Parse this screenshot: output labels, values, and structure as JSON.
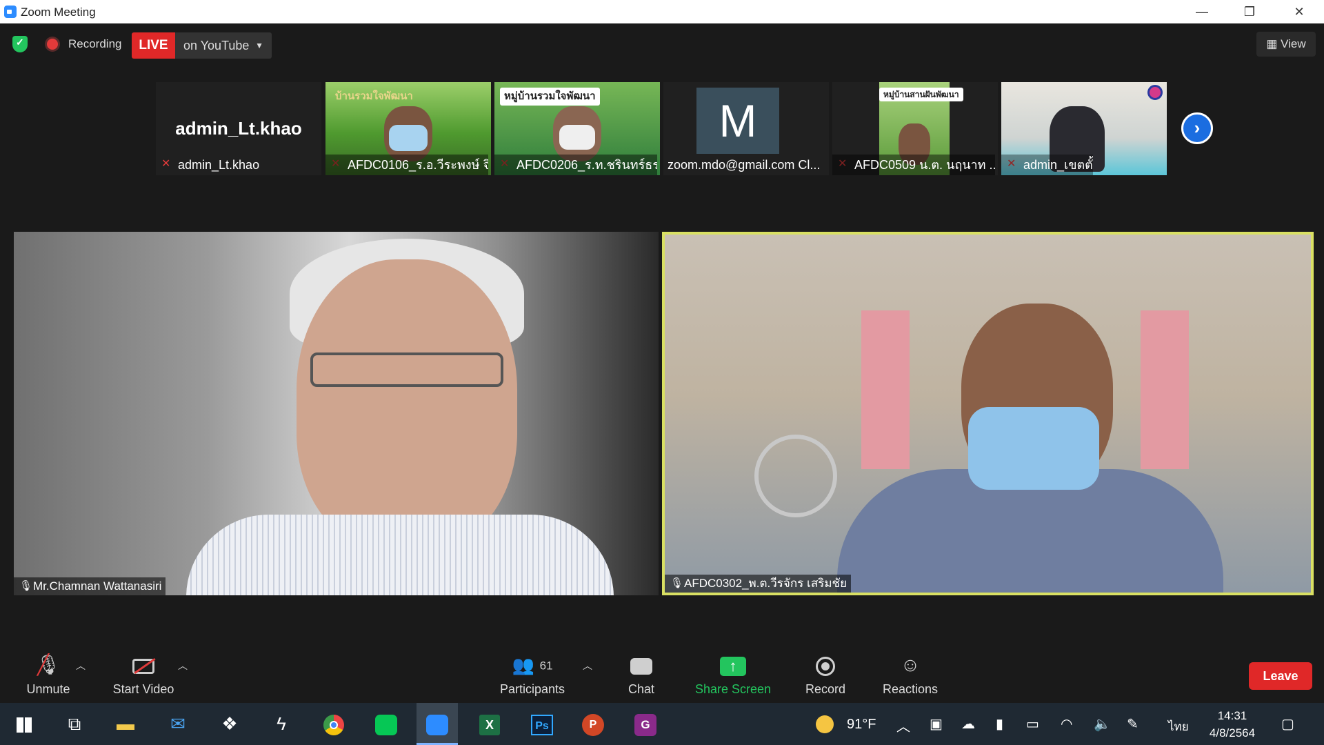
{
  "window": {
    "title": "Zoom Meeting",
    "minimize": "—",
    "restore": "❐",
    "close": "✕"
  },
  "status": {
    "recording": "Recording",
    "live": "LIVE",
    "stream_target": "on YouTube",
    "view": "View"
  },
  "thumbnails": [
    {
      "name": "admin_Lt.khao",
      "display": "admin_Lt.khao"
    },
    {
      "name": "AFDC0106_ร.อ.วีระพงษ์ จิ...",
      "banner": "บ้านรวมใจพัฒนา"
    },
    {
      "name": "AFDC0206_ร.ท.ชรินทร์ธร...",
      "banner": "หมู่บ้านรวมใจพัฒนา"
    },
    {
      "name": "zoom.mdo@gmail.com Cl...",
      "avatar": "M"
    },
    {
      "name": "AFDC0509 น.ต. นฤนาท ...",
      "banner": "หมู่บ้านสานฝันพัฒนา"
    },
    {
      "name": "admin_เขตตั้"
    }
  ],
  "videos": {
    "left": {
      "name": "Mr.Chamnan Wattanasiri"
    },
    "right": {
      "name": "AFDC0302_พ.ต.วีรจักร  เสริมชัย"
    }
  },
  "toolbar": {
    "unmute": "Unmute",
    "start_video": "Start Video",
    "participants": "Participants",
    "participants_count": "61",
    "chat": "Chat",
    "share_screen": "Share Screen",
    "record": "Record",
    "reactions": "Reactions",
    "leave": "Leave"
  },
  "taskbar": {
    "temperature": "91°F",
    "language": "ไทย",
    "time": "14:31",
    "date": "4/8/2564"
  },
  "colors": {
    "live_red": "#e02828",
    "share_green": "#23c55e",
    "active_speaker_border": "#d9e063",
    "zoom_blue": "#2d8cff"
  }
}
